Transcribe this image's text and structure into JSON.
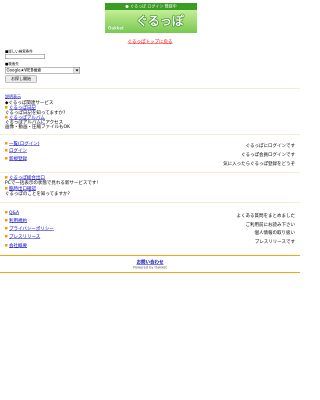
{
  "header": {
    "banner_text": "● ぐるっぽ ログイン 登録中",
    "logo_small": "Oakket",
    "logo_main": "ぐるっぽ",
    "top_link": "ぐるっぽトップに戻る"
  },
  "search": {
    "condition_label": "■詳しい検索条件",
    "query_value": "",
    "target_label": "■検索先",
    "target_selected": "Google★WEB検索",
    "submit_label": "お探し開始"
  },
  "help": {
    "link": "説明表示"
  },
  "services": {
    "heading": "◆ぐるっぽ関連サービス",
    "items": [
      {
        "link": "ぐるっぽ日記",
        "desc": [
          "ぐるっぽ日記を知ってますか?"
        ]
      },
      {
        "link": "ぐるっぽアルバム",
        "desc": [
          "ぐるっぽアルバムにアクセス",
          "画像・動画・圧縮ファイルもOK"
        ]
      }
    ]
  },
  "account": {
    "rows": [
      {
        "link": "一覧(ログイン)",
        "desc": "ぐるっぽにログインです"
      },
      {
        "link": "ログイン",
        "desc": "ぐるっぽ会員ログインです"
      },
      {
        "link": "新規登録",
        "desc": "気に入ったらぐるっぽ登録をどうぞ"
      }
    ]
  },
  "extras": {
    "items": [
      {
        "link": "ぐるっぽ総合出口",
        "desc": "PCで一括表示の状態で見れる新サービスです!"
      },
      {
        "link": "臨時出口確認",
        "desc": "ぐるっぽのことを知ってますか?"
      }
    ]
  },
  "info": {
    "rows": [
      {
        "link": "Q&A",
        "desc": "よくある質問をまとめました"
      },
      {
        "link": "利用規約",
        "desc": "ご利用前にお読み下さい"
      },
      {
        "link": "プライバシーポリシー",
        "desc": "個人情報の取り扱い"
      },
      {
        "link": "プレスリリース",
        "desc": "プレスリリースです"
      },
      {
        "link": "会社概要"
      }
    ]
  },
  "footer": {
    "contact_link": "お問い合わせ",
    "powered_by": "Powered by Oakket"
  },
  "colors": {
    "brand_green": "#3a9d23",
    "link_blue": "#0000cc",
    "top_link_red": "#ff0000",
    "accent_orange": "#f7a21b"
  },
  "icons": [
    "bullet-icon",
    "chevron-down-icon"
  ]
}
